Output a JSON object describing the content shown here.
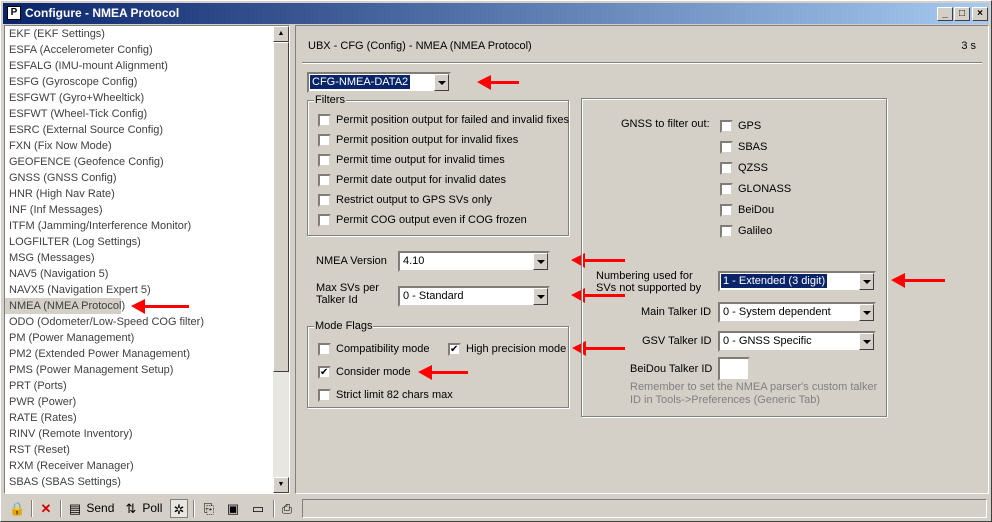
{
  "window": {
    "title": "Configure - NMEA Protocol",
    "app_icon": "P"
  },
  "left_list": {
    "items": [
      "EKF (EKF Settings)",
      "ESFA (Accelerometer Config)",
      "ESFALG (IMU-mount Alignment)",
      "ESFG (Gyroscope Config)",
      "ESFGWT (Gyro+Wheeltick)",
      "ESFWT (Wheel-Tick Config)",
      "ESRC (External Source Config)",
      "FXN (Fix Now Mode)",
      "GEOFENCE (Geofence Config)",
      "GNSS (GNSS Config)",
      "HNR (High Nav Rate)",
      "INF (Inf Messages)",
      "ITFM (Jamming/Interference Monitor)",
      "LOGFILTER (Log Settings)",
      "MSG (Messages)",
      "NAV5 (Navigation 5)",
      "NAVX5 (Navigation Expert 5)",
      "NMEA (NMEA Protocol)",
      "ODO (Odometer/Low-Speed COG filter)",
      "PM (Power Management)",
      "PM2 (Extended Power Management)",
      "PMS (Power Management Setup)",
      "PRT (Ports)",
      "PWR (Power)",
      "RATE (Rates)",
      "RINV (Remote Inventory)",
      "RST (Reset)",
      "RXM (Receiver Manager)",
      "SBAS (SBAS Settings)"
    ],
    "selected": "NMEA (NMEA Protocol)"
  },
  "header": {
    "title": "UBX - CFG (Config) - NMEA (NMEA Protocol)",
    "age": "3 s"
  },
  "message_select": {
    "value": "CFG-NMEA-DATA2"
  },
  "filters": {
    "label": "Filters",
    "items": [
      {
        "label": "Permit position output for failed and invalid fixes",
        "checked": false
      },
      {
        "label": "Permit position output for invalid fixes",
        "checked": false
      },
      {
        "label": "Permit time output for invalid times",
        "checked": false
      },
      {
        "label": "Permit date output for invalid dates",
        "checked": false
      },
      {
        "label": "Restrict output to GPS SVs only",
        "checked": false
      },
      {
        "label": "Permit COG output even if COG frozen",
        "checked": false
      }
    ]
  },
  "nmea_version": {
    "label": "NMEA Version",
    "value": "4.10"
  },
  "max_svs": {
    "label_line1": "Max SVs per",
    "label_line2": "Talker Id",
    "value": "0 - Standard"
  },
  "mode_flags": {
    "label": "Mode Flags",
    "compatibility": {
      "label": "Compatibility mode",
      "checked": false
    },
    "high_precision": {
      "label": "High precision mode",
      "checked": true
    },
    "consider": {
      "label": "Consider mode",
      "checked": true
    },
    "strict_limit": {
      "label": "Strict limit 82 chars max",
      "checked": false
    }
  },
  "gnss_filter": {
    "label": "GNSS to filter out:",
    "items": [
      {
        "label": "GPS",
        "checked": false
      },
      {
        "label": "SBAS",
        "checked": false
      },
      {
        "label": "QZSS",
        "checked": false
      },
      {
        "label": "GLONASS",
        "checked": false
      },
      {
        "label": "BeiDou",
        "checked": false
      },
      {
        "label": "Galileo",
        "checked": false
      }
    ]
  },
  "numbering": {
    "label_line1": "Numbering used for",
    "label_line2": "SVs not supported by",
    "value": "1 - Extended (3 digit)"
  },
  "main_talker": {
    "label": "Main Talker ID",
    "value": "0 - System dependent"
  },
  "gsv_talker": {
    "label": "GSV Talker ID",
    "value": "0 - GNSS Specific"
  },
  "beidou_talker": {
    "label": "BeiDou Talker ID",
    "value": ""
  },
  "note": {
    "line1": "Remember to set the NMEA parser's custom talker",
    "line2": "ID in Tools->Preferences (Generic Tab)"
  },
  "toolbar": {
    "send_label": "Send",
    "poll_label": "Poll"
  },
  "colors": {
    "arrow": "#ff0000",
    "title_bar": "#0a246a",
    "selection": "#0a246a"
  }
}
